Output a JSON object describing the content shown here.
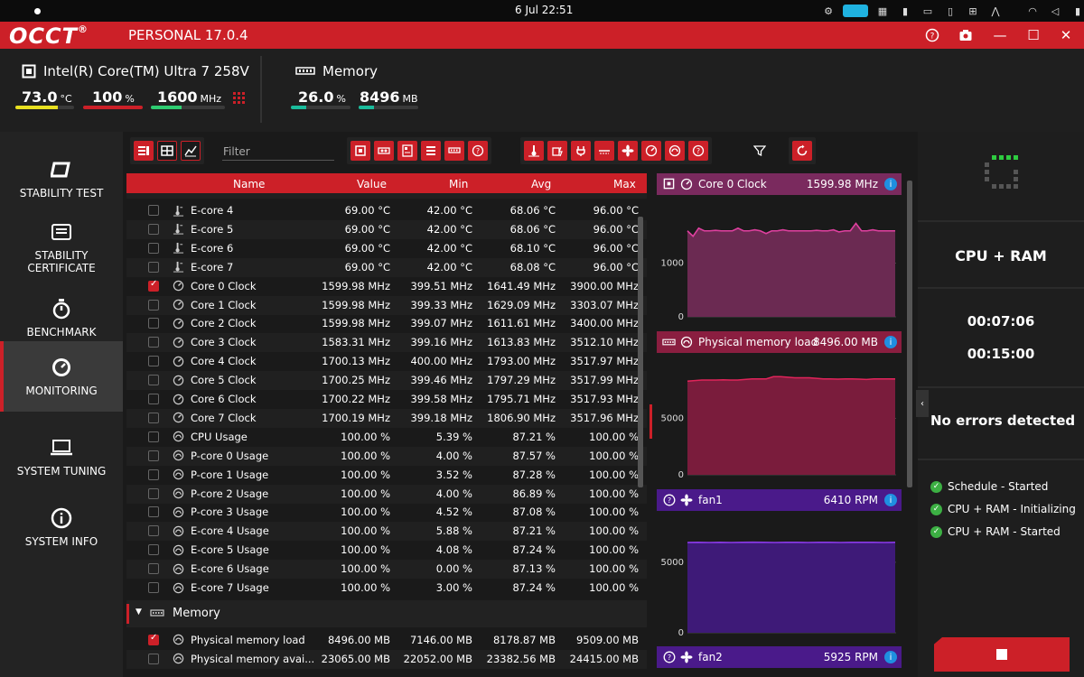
{
  "statusbar": {
    "clock": "6 Jul  22:51"
  },
  "app": {
    "logo": "OCCT",
    "edition": "PERSONAL 17.0.4"
  },
  "header": {
    "cpu": {
      "name": "Intel(R) Core(TM) Ultra 7 258V",
      "temp": "73.0",
      "temp_unit": "°C",
      "load": "100",
      "load_unit": "%",
      "clock": "1600",
      "clock_unit": "MHz",
      "temp_fill": 0.73,
      "load_fill": 1.0,
      "clock_fill": 0.41,
      "temp_color": "#e8e020",
      "load_color": "#cc2028",
      "clock_color": "#2ecc71"
    },
    "memory": {
      "name": "Memory",
      "load": "26.0",
      "load_unit": "%",
      "used": "8496",
      "used_unit": "MB",
      "load_fill": 0.26,
      "used_fill": 0.26,
      "color": "#1abc9c"
    }
  },
  "sidebar": {
    "items": [
      {
        "label": "STABILITY TEST",
        "icon": "occt-logo-icon"
      },
      {
        "label": "STABILITY CERTIFICATE",
        "icon": "certificate-icon"
      },
      {
        "label": "BENCHMARK",
        "icon": "stopwatch-icon"
      },
      {
        "label": "MONITORING",
        "icon": "gauge-icon",
        "active": true
      },
      {
        "label": "SYSTEM TUNING",
        "icon": "laptop-icon"
      },
      {
        "label": "SYSTEM INFO",
        "icon": "info-icon"
      }
    ]
  },
  "toolbar": {
    "filter_placeholder": "Filter"
  },
  "table": {
    "headers": {
      "name": "Name",
      "value": "Value",
      "min": "Min",
      "avg": "Avg",
      "max": "Max"
    },
    "rows": [
      {
        "name": "E-core 4",
        "icon": "temperature-icon",
        "value": "69.00 °C",
        "min": "42.00 °C",
        "avg": "68.06 °C",
        "max": "96.00 °C",
        "checked": false
      },
      {
        "name": "E-core 5",
        "icon": "temperature-icon",
        "value": "69.00 °C",
        "min": "42.00 °C",
        "avg": "68.06 °C",
        "max": "96.00 °C",
        "checked": false
      },
      {
        "name": "E-core 6",
        "icon": "temperature-icon",
        "value": "69.00 °C",
        "min": "42.00 °C",
        "avg": "68.10 °C",
        "max": "96.00 °C",
        "checked": false
      },
      {
        "name": "E-core 7",
        "icon": "temperature-icon",
        "value": "69.00 °C",
        "min": "42.00 °C",
        "avg": "68.08 °C",
        "max": "96.00 °C",
        "checked": false
      },
      {
        "name": "Core 0 Clock",
        "icon": "clock-gauge-icon",
        "value": "1599.98 MHz",
        "min": "399.51 MHz",
        "avg": "1641.49 MHz",
        "max": "3900.00 MHz",
        "checked": true
      },
      {
        "name": "Core 1 Clock",
        "icon": "clock-gauge-icon",
        "value": "1599.98 MHz",
        "min": "399.33 MHz",
        "avg": "1629.09 MHz",
        "max": "3303.07 MHz",
        "checked": false
      },
      {
        "name": "Core 2 Clock",
        "icon": "clock-gauge-icon",
        "value": "1599.98 MHz",
        "min": "399.07 MHz",
        "avg": "1611.61 MHz",
        "max": "3400.00 MHz",
        "checked": false
      },
      {
        "name": "Core 3 Clock",
        "icon": "clock-gauge-icon",
        "value": "1583.31 MHz",
        "min": "399.16 MHz",
        "avg": "1613.83 MHz",
        "max": "3512.10 MHz",
        "checked": false
      },
      {
        "name": "Core 4 Clock",
        "icon": "clock-gauge-icon",
        "value": "1700.13 MHz",
        "min": "400.00 MHz",
        "avg": "1793.00 MHz",
        "max": "3517.97 MHz",
        "checked": false
      },
      {
        "name": "Core 5 Clock",
        "icon": "clock-gauge-icon",
        "value": "1700.25 MHz",
        "min": "399.46 MHz",
        "avg": "1797.29 MHz",
        "max": "3517.99 MHz",
        "checked": false
      },
      {
        "name": "Core 6 Clock",
        "icon": "clock-gauge-icon",
        "value": "1700.22 MHz",
        "min": "399.58 MHz",
        "avg": "1795.71 MHz",
        "max": "3517.93 MHz",
        "checked": false
      },
      {
        "name": "Core 7 Clock",
        "icon": "clock-gauge-icon",
        "value": "1700.19 MHz",
        "min": "399.18 MHz",
        "avg": "1806.90 MHz",
        "max": "3517.96 MHz",
        "checked": false
      },
      {
        "name": "CPU Usage",
        "icon": "usage-gauge-icon",
        "value": "100.00 %",
        "min": "5.39 %",
        "avg": "87.21 %",
        "max": "100.00 %",
        "checked": false
      },
      {
        "name": "P-core 0 Usage",
        "icon": "usage-gauge-icon",
        "value": "100.00 %",
        "min": "4.00 %",
        "avg": "87.57 %",
        "max": "100.00 %",
        "checked": false
      },
      {
        "name": "P-core 1 Usage",
        "icon": "usage-gauge-icon",
        "value": "100.00 %",
        "min": "3.52 %",
        "avg": "87.28 %",
        "max": "100.00 %",
        "checked": false
      },
      {
        "name": "P-core 2 Usage",
        "icon": "usage-gauge-icon",
        "value": "100.00 %",
        "min": "4.00 %",
        "avg": "86.89 %",
        "max": "100.00 %",
        "checked": false
      },
      {
        "name": "P-core 3 Usage",
        "icon": "usage-gauge-icon",
        "value": "100.00 %",
        "min": "4.52 %",
        "avg": "87.08 %",
        "max": "100.00 %",
        "checked": false
      },
      {
        "name": "E-core 4 Usage",
        "icon": "usage-gauge-icon",
        "value": "100.00 %",
        "min": "5.88 %",
        "avg": "87.21 %",
        "max": "100.00 %",
        "checked": false
      },
      {
        "name": "E-core 5 Usage",
        "icon": "usage-gauge-icon",
        "value": "100.00 %",
        "min": "4.08 %",
        "avg": "87.24 %",
        "max": "100.00 %",
        "checked": false
      },
      {
        "name": "E-core 6 Usage",
        "icon": "usage-gauge-icon",
        "value": "100.00 %",
        "min": "0.00 %",
        "avg": "87.13 %",
        "max": "100.00 %",
        "checked": false
      },
      {
        "name": "E-core 7 Usage",
        "icon": "usage-gauge-icon",
        "value": "100.00 %",
        "min": "3.00 %",
        "avg": "87.24 %",
        "max": "100.00 %",
        "checked": false
      }
    ],
    "group": {
      "label": "Memory",
      "icon": "memory-icon"
    },
    "mem_rows": [
      {
        "name": "Physical memory load",
        "icon": "usage-gauge-icon",
        "value": "8496.00 MB",
        "min": "7146.00 MB",
        "avg": "8178.87 MB",
        "max": "9509.00 MB",
        "checked": true
      },
      {
        "name": "Physical memory avai...",
        "icon": "usage-gauge-icon",
        "value": "23065.00 MB",
        "min": "22052.00 MB",
        "avg": "23382.56 MB",
        "max": "24415.00 MB",
        "checked": false
      }
    ]
  },
  "charts": [
    {
      "title": "Core 0 Clock",
      "value": "1599.98 MHz",
      "header_color": "#7a2a5e",
      "fill": "#6b2a52",
      "line": "#e040a0",
      "icon1": "cpu-icon",
      "icon2": "clock-gauge-icon",
      "ticks": [
        "1000",
        "0"
      ]
    },
    {
      "title": "Physical memory load",
      "value": "8496.00 MB",
      "header_color": "#8a1e40",
      "fill": "#7a1c3c",
      "line": "#e0245a",
      "icon1": "memory-icon",
      "icon2": "usage-gauge-icon",
      "ticks": [
        "5000",
        "0"
      ]
    },
    {
      "title": "fan1",
      "value": "6410 RPM",
      "header_color": "#4a1a8a",
      "fill": "#3e1a78",
      "line": "#8a3ae8",
      "icon1": "help-icon",
      "icon2": "fan-icon",
      "ticks": [
        "5000",
        "0"
      ]
    },
    {
      "title": "fan2",
      "value": "5925 RPM",
      "header_color": "#4a1a8a",
      "fill": "#3e1a78",
      "line": "#8a3ae8",
      "icon1": "help-icon",
      "icon2": "fan-icon",
      "ticks": []
    }
  ],
  "chart_data": [
    {
      "type": "area",
      "title": "Core 0 Clock",
      "ylabel": "",
      "yticks": [
        0,
        1000
      ],
      "ylim": [
        0,
        2100
      ],
      "values": [
        1600,
        1500,
        1650,
        1600,
        1600,
        1610,
        1600,
        1600,
        1600,
        1650,
        1600,
        1600,
        1620,
        1600,
        1550,
        1600,
        1600,
        1620,
        1600,
        1600,
        1600,
        1600,
        1600,
        1610,
        1600,
        1600,
        1620,
        1580,
        1600,
        1600,
        1740,
        1600,
        1600,
        1620,
        1600,
        1600,
        1600,
        1600
      ]
    },
    {
      "type": "area",
      "title": "Physical memory load",
      "ylabel": "",
      "yticks": [
        0,
        5000
      ],
      "ylim": [
        0,
        10000
      ],
      "values": [
        8300,
        8350,
        8400,
        8400,
        8400,
        8420,
        8400,
        8400,
        8450,
        8500,
        8500,
        8500,
        8700,
        8700,
        8650,
        8600,
        8600,
        8600,
        8550,
        8500,
        8500,
        8480,
        8500,
        8500,
        8480,
        8450,
        8500,
        8500,
        8500,
        8496
      ]
    },
    {
      "type": "area",
      "title": "fan1",
      "ylabel": "",
      "yticks": [
        0,
        5000
      ],
      "ylim": [
        0,
        8000
      ],
      "values": [
        6400,
        6410,
        6400,
        6410,
        6400,
        6410,
        6420,
        6410,
        6400,
        6410,
        6410,
        6400,
        6410,
        6410,
        6400,
        6410,
        6410,
        6410,
        6400,
        6410
      ]
    }
  ],
  "right": {
    "mode": "CPU + RAM",
    "elapsed": "00:07:06",
    "duration": "00:15:00",
    "status": "No errors detected",
    "log": [
      "Schedule - Started",
      "CPU + RAM - Initializing",
      "CPU + RAM - Started"
    ]
  }
}
